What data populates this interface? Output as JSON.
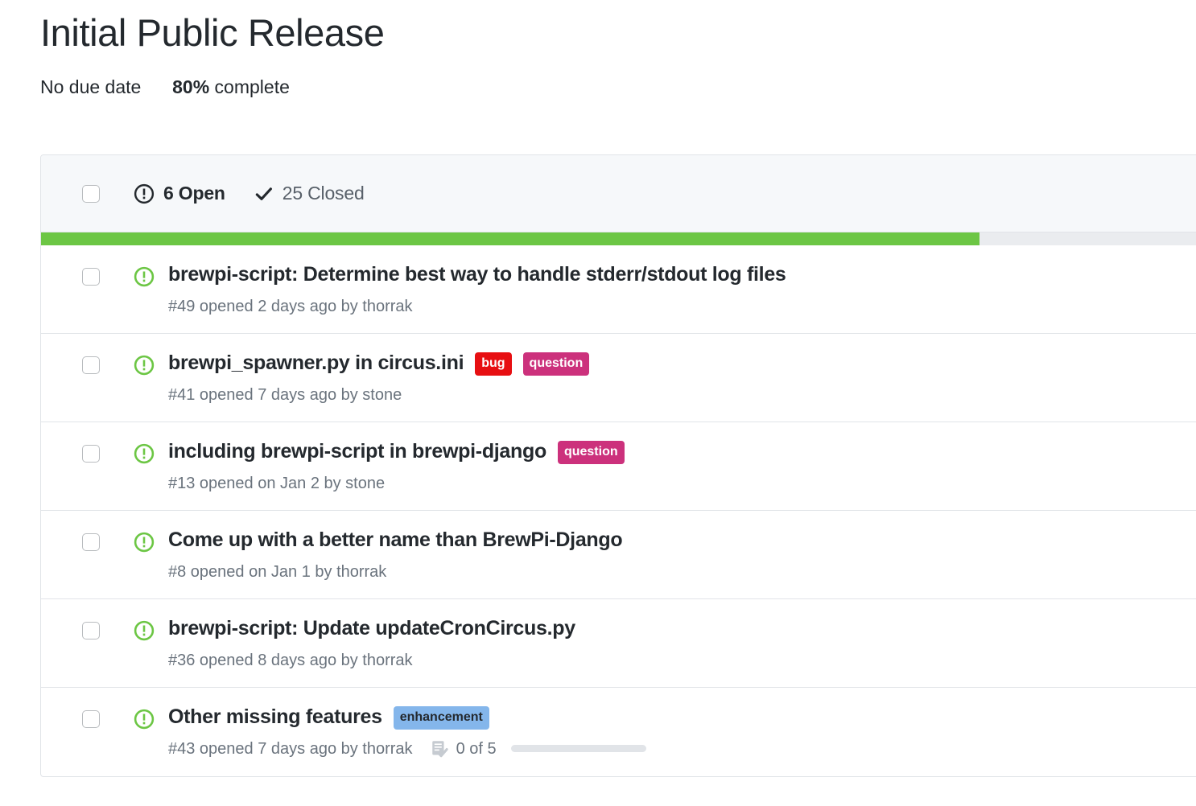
{
  "milestone": {
    "title": "Initial Public Release",
    "due_date": "No due date",
    "percent_complete": "80%",
    "complete_suffix": " complete",
    "progress_percent": 80,
    "progress_color": "#6cc644",
    "track_color": "#eaecef"
  },
  "list_header": {
    "open_count_label": "6 Open",
    "closed_count_label": "25 Closed",
    "open_icon": "issue-opened-icon",
    "closed_icon": "check-icon"
  },
  "labels_palette": {
    "bug": {
      "bg": "#e70f12",
      "fg": "#ffffff"
    },
    "question": {
      "bg": "#cc317c",
      "fg": "#ffffff"
    },
    "enhancement": {
      "bg": "#84b6eb",
      "fg": "#24292e"
    }
  },
  "issues": [
    {
      "title": "brewpi-script: Determine best way to handle stderr/stdout log files",
      "meta": "#49 opened 2 days ago by thorrak",
      "state_icon": "issue-opened-icon",
      "labels": [],
      "tasks": null
    },
    {
      "title": "brewpi_spawner.py in circus.ini",
      "meta": "#41 opened 7 days ago by stone",
      "state_icon": "issue-opened-icon",
      "labels": [
        {
          "text": "bug",
          "bg": "#e70f12",
          "fg": "#ffffff"
        },
        {
          "text": "question",
          "bg": "#cc317c",
          "fg": "#ffffff"
        }
      ],
      "tasks": null
    },
    {
      "title": "including brewpi-script in brewpi-django",
      "meta": "#13 opened on Jan 2 by stone",
      "state_icon": "issue-opened-icon",
      "labels": [
        {
          "text": "question",
          "bg": "#cc317c",
          "fg": "#ffffff"
        }
      ],
      "tasks": null
    },
    {
      "title": "Come up with a better name than BrewPi-Django",
      "meta": "#8 opened on Jan 1 by thorrak",
      "state_icon": "issue-opened-icon",
      "labels": [],
      "tasks": null
    },
    {
      "title": "brewpi-script: Update updateCronCircus.py",
      "meta": "#36 opened 8 days ago by thorrak",
      "state_icon": "issue-opened-icon",
      "labels": [],
      "tasks": null
    },
    {
      "title": "Other missing features",
      "meta": "#43 opened 7 days ago by thorrak",
      "state_icon": "issue-opened-icon",
      "labels": [
        {
          "text": "enhancement",
          "bg": "#84b6eb",
          "fg": "#24292e"
        }
      ],
      "tasks": {
        "label": "0 of 5",
        "done": 0,
        "total": 5,
        "icon": "tasklist-icon"
      }
    }
  ]
}
